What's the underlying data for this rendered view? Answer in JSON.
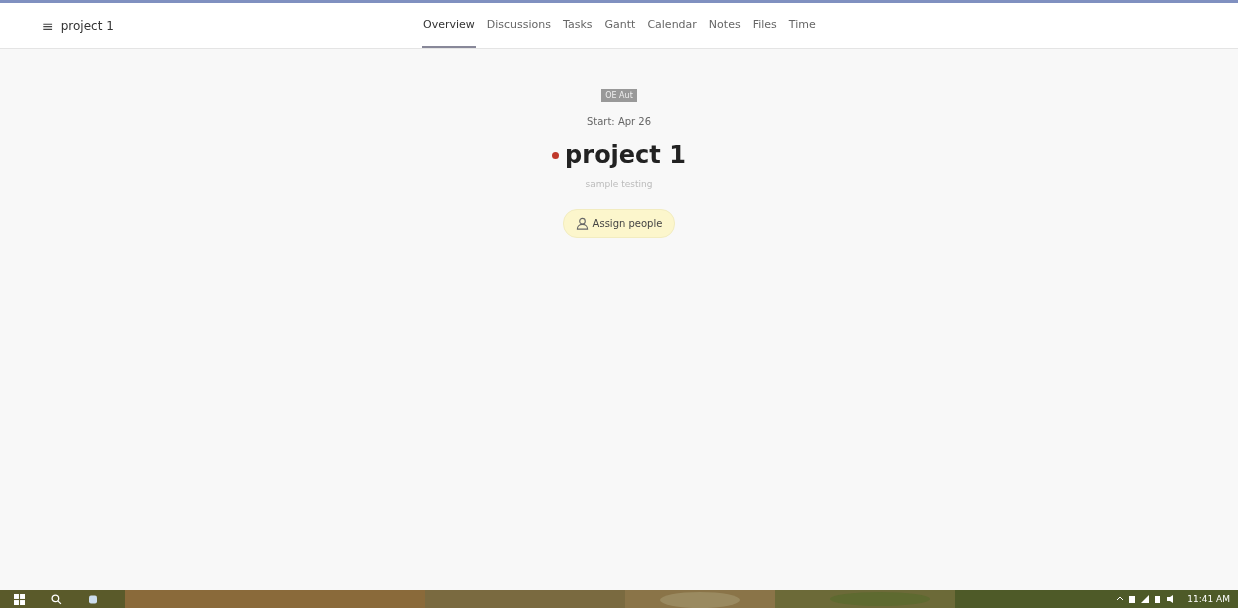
{
  "header": {
    "menu_icon": "≡",
    "title": "project 1"
  },
  "tabs": [
    {
      "label": "Overview",
      "selected": true
    },
    {
      "label": "Discussions",
      "selected": false
    },
    {
      "label": "Tasks",
      "selected": false
    },
    {
      "label": "Gantt",
      "selected": false
    },
    {
      "label": "Calendar",
      "selected": false
    },
    {
      "label": "Notes",
      "selected": false
    },
    {
      "label": "Files",
      "selected": false
    },
    {
      "label": "Time",
      "selected": false
    }
  ],
  "project": {
    "badge": "OE Aut",
    "start": "Start: Apr 26",
    "color": "#c0392b",
    "name": "project 1",
    "description": "sample testing",
    "assign_button": "Assign people"
  },
  "taskbar": {
    "clock": "11:41 AM"
  }
}
